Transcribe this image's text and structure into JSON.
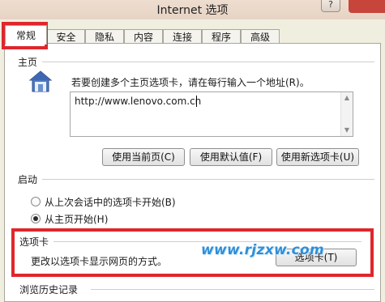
{
  "window": {
    "title": "Internet 选项",
    "help_glyph": "?"
  },
  "tabs": [
    {
      "label": "常规",
      "active": true
    },
    {
      "label": "安全"
    },
    {
      "label": "隐私"
    },
    {
      "label": "内容"
    },
    {
      "label": "连接"
    },
    {
      "label": "程序"
    },
    {
      "label": "高级"
    }
  ],
  "homepage": {
    "section_title": "主页",
    "description": "若要创建多个主页选项卡，请在每行输入一个地址(R)。",
    "url": "http://www.lenovo.com.cn",
    "buttons": {
      "use_current": "使用当前页(C)",
      "use_default": "使用默认值(F)",
      "use_new_tab": "使用新选项卡(U)"
    }
  },
  "startup": {
    "section_title": "启动",
    "options": [
      {
        "label": "从上次会话中的选项卡开始(B)",
        "checked": false
      },
      {
        "label": "从主页开始(H)",
        "checked": true
      }
    ]
  },
  "tabs_section": {
    "section_title": "选项卡",
    "description": "更改以选项卡显示网页的方式。",
    "button": "选项卡(T)"
  },
  "history": {
    "section_title": "浏览历史记录"
  },
  "watermark": "www.rjzxw.com",
  "colors": {
    "highlight": "#e0262c",
    "watermark": "#2e8fd8",
    "dialog_bg": "#f0eedf"
  }
}
